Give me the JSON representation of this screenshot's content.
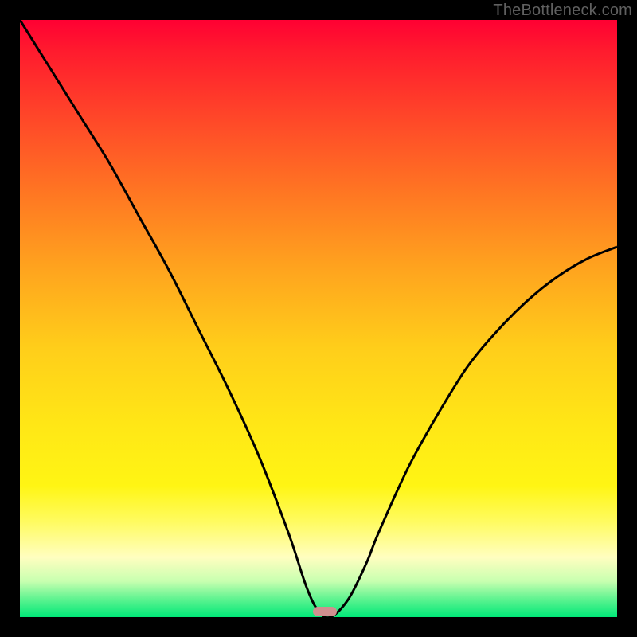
{
  "watermark": "TheBottleneck.com",
  "chart_data": {
    "type": "line",
    "title": "",
    "xlabel": "",
    "ylabel": "",
    "xlim": [
      0,
      100
    ],
    "ylim": [
      0,
      100
    ],
    "x": [
      0,
      5,
      10,
      15,
      20,
      25,
      30,
      35,
      40,
      45,
      48,
      50,
      52,
      55,
      58,
      60,
      65,
      70,
      75,
      80,
      85,
      90,
      95,
      100
    ],
    "y": [
      100,
      92,
      84,
      76,
      67,
      58,
      48,
      38,
      27,
      14,
      5,
      1,
      0,
      3,
      9,
      14,
      25,
      34,
      42,
      48,
      53,
      57,
      60,
      62
    ],
    "marker": {
      "x": 51,
      "y": 1
    }
  }
}
